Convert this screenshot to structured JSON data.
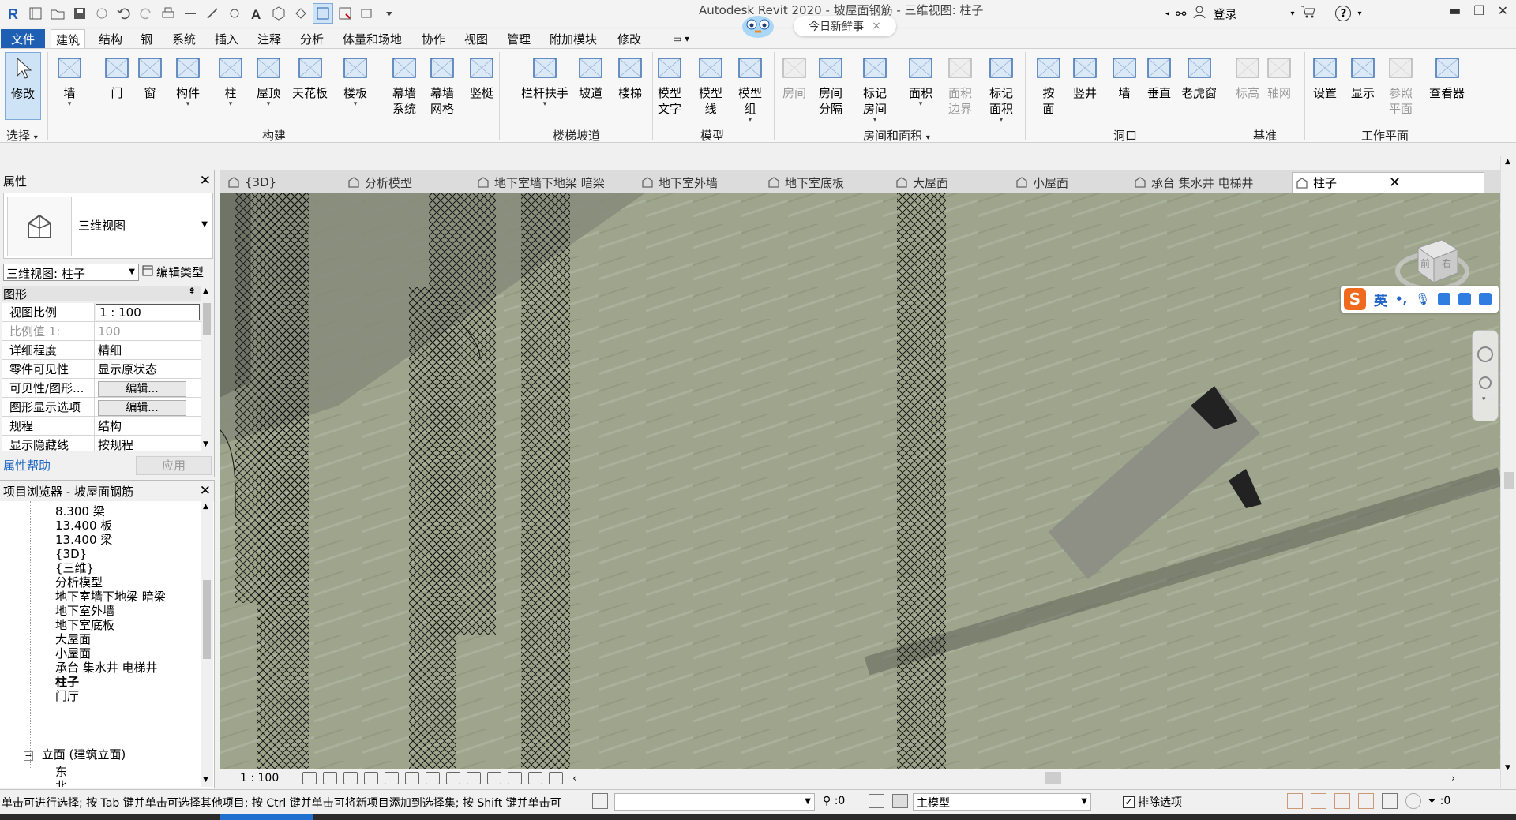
{
  "titlebar": {
    "title": "Autodesk Revit 2020 - 坡屋面钢筋 - 三维视图: 柱子",
    "news_label": "今日新鲜事",
    "news_close": "×",
    "login_label": "登录",
    "help_label": "?"
  },
  "menu": {
    "file": "文件",
    "tabs": [
      "建筑",
      "结构",
      "钢",
      "系统",
      "插入",
      "注释",
      "分析",
      "体量和场地",
      "协作",
      "视图",
      "管理",
      "附加模块",
      "修改"
    ]
  },
  "ribbon": {
    "select_tool": "修改",
    "select_panel": "选择",
    "tools": [
      {
        "icon": "wall-icon",
        "label": "墙",
        "dropdown": true
      },
      {
        "icon": "door-icon",
        "label": "门",
        "dropdown": false
      },
      {
        "icon": "window-icon",
        "label": "窗",
        "dropdown": false
      },
      {
        "icon": "component-icon",
        "label": "构件",
        "dropdown": true
      },
      {
        "icon": "column-icon",
        "label": "柱",
        "dropdown": true
      },
      {
        "icon": "roof-icon",
        "label": "屋顶",
        "dropdown": true
      },
      {
        "icon": "ceiling-icon",
        "label": "天花板",
        "dropdown": false
      },
      {
        "icon": "floor-icon",
        "label": "楼板",
        "dropdown": true
      },
      {
        "icon": "curtain-system-icon",
        "label": "幕墙\n系统",
        "dropdown": false
      },
      {
        "icon": "curtain-grid-icon",
        "label": "幕墙\n网格",
        "dropdown": false
      },
      {
        "icon": "mullion-icon",
        "label": "竖梃",
        "dropdown": false
      },
      {
        "icon": "railing-icon",
        "label": "栏杆扶手",
        "dropdown": true
      },
      {
        "icon": "ramp-icon",
        "label": "坡道",
        "dropdown": false
      },
      {
        "icon": "stair-icon",
        "label": "楼梯",
        "dropdown": false
      },
      {
        "icon": "model-text-icon",
        "label": "模型\n文字",
        "dropdown": false
      },
      {
        "icon": "model-line-icon",
        "label": "模型\n线",
        "dropdown": false
      },
      {
        "icon": "model-group-icon",
        "label": "模型\n组",
        "dropdown": true
      },
      {
        "icon": "room-icon",
        "label": "房间",
        "dropdown": false,
        "disabled": true
      },
      {
        "icon": "room-separator-icon",
        "label": "房间\n分隔",
        "dropdown": false
      },
      {
        "icon": "tag-room-icon",
        "label": "标记\n房间",
        "dropdown": true
      },
      {
        "icon": "area-icon",
        "label": "面积",
        "dropdown": true
      },
      {
        "icon": "area-boundary-icon",
        "label": "面积\n边界",
        "dropdown": false,
        "disabled": true
      },
      {
        "icon": "tag-area-icon",
        "label": "标记\n面积",
        "dropdown": true
      },
      {
        "icon": "by-face-icon",
        "label": "按\n面",
        "dropdown": false
      },
      {
        "icon": "shaft-icon",
        "label": "竖井",
        "dropdown": false
      },
      {
        "icon": "wall-opening-icon",
        "label": "墙",
        "dropdown": false
      },
      {
        "icon": "vertical-opening-icon",
        "label": "垂直",
        "dropdown": false
      },
      {
        "icon": "dormer-icon",
        "label": "老虎窗",
        "dropdown": false
      },
      {
        "icon": "level-icon",
        "label": "标高",
        "dropdown": false,
        "disabled": true
      },
      {
        "icon": "grid-icon",
        "label": "轴网",
        "dropdown": false,
        "disabled": true
      },
      {
        "icon": "set-workplane-icon",
        "label": "设置",
        "dropdown": false
      },
      {
        "icon": "show-workplane-icon",
        "label": "显示",
        "dropdown": false
      },
      {
        "icon": "ref-plane-icon",
        "label": "参照\n平面",
        "dropdown": false,
        "disabled": true
      },
      {
        "icon": "viewer-icon",
        "label": "查看器",
        "dropdown": false
      }
    ],
    "panels": [
      "构建",
      "楼梯坡道",
      "模型",
      "房间和面积",
      "洞口",
      "基准",
      "工作平面"
    ]
  },
  "properties": {
    "title": "属性",
    "close": "✕",
    "type_name": "三维视图",
    "view_selector": "三维视图: 柱子",
    "edit_type": "编辑类型",
    "group": "图形",
    "rows": [
      {
        "key": "视图比例",
        "value": "1 : 100"
      },
      {
        "key": "比例值 1:",
        "value": "100"
      },
      {
        "key": "详细程度",
        "value": "精细"
      },
      {
        "key": "零件可见性",
        "value": "显示原状态"
      },
      {
        "key": "可见性/图形...",
        "value": "编辑..."
      },
      {
        "key": "图形显示选项",
        "value": "编辑..."
      },
      {
        "key": "规程",
        "value": "结构"
      },
      {
        "key": "显示隐藏线",
        "value": "按规程"
      }
    ],
    "help": "属性帮助",
    "apply": "应用"
  },
  "browser": {
    "title": "项目浏览器 - 坡屋面钢筋",
    "close": "✕",
    "items": [
      "8.300 梁",
      "13.400 板",
      "13.400 梁",
      "{3D}",
      "{三维}",
      "分析模型",
      "地下室墙下地梁 暗梁",
      "地下室外墙",
      "地下室底板",
      "大屋面",
      "小屋面",
      "承台 集水井 电梯井",
      "柱子",
      "门厅"
    ],
    "elevation_group": "立面 (建筑立面)",
    "elevation_toggle": "−",
    "elevation_item": "东",
    "elevation_item_next": "北"
  },
  "view_tabs": [
    "{3D}",
    "分析模型",
    "地下室墙下地梁 暗梁",
    "地下室外墙",
    "地下室底板",
    "大屋面",
    "小屋面",
    "承台 集水井 电梯井",
    "柱子"
  ],
  "view_tab_close": "✕",
  "view_control": {
    "scale": "1 : 100"
  },
  "viewcube": {
    "front": "前",
    "right": "右"
  },
  "ime": {
    "lang": "英",
    "punct": "•,"
  },
  "statusbar": {
    "hint": "单击可进行选择; 按 Tab 键并单击可选择其他项目; 按 Ctrl 键并单击可将新项目添加到选择集; 按 Shift 键并单击可",
    "selected_count": ":0",
    "active_model": "主模型",
    "exclude_label": "排除选项",
    "exclude_checked": "✓",
    "filter_count": ":0"
  }
}
